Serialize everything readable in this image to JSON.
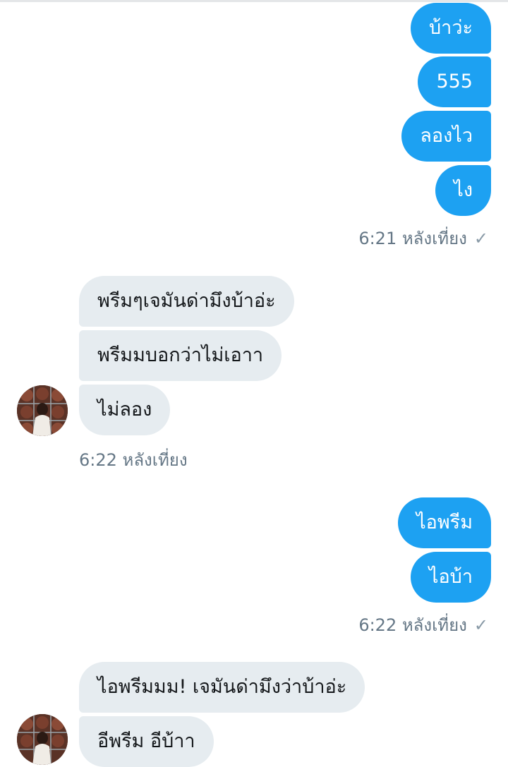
{
  "conversation": {
    "group1_out": [
      "บ้าว่ะ",
      "555",
      "ลองไว",
      "ไง"
    ],
    "time1": "6:21 หลังเที่ยง",
    "group2_in": [
      "พรีมๆเจมันด่ามึงบ้าอ่ะ",
      "พรีมมบอกว่าไม่เอาา",
      "ไม่ลอง"
    ],
    "time2": "6:22 หลังเที่ยง",
    "group3_out": [
      "ไอพรีม",
      "ไอบ้า"
    ],
    "time3": "6:22 หลังเที่ยง",
    "group4_in": [
      "ไอพรีมมม! เจมันด่ามึงว่าบ้าอ่ะ",
      "อีพรีม อีบ้าา"
    ],
    "read_icon": "check-icon"
  },
  "colors": {
    "outgoing": "#1da1f2",
    "incoming": "#e6ecf0",
    "meta_text": "#657786"
  }
}
